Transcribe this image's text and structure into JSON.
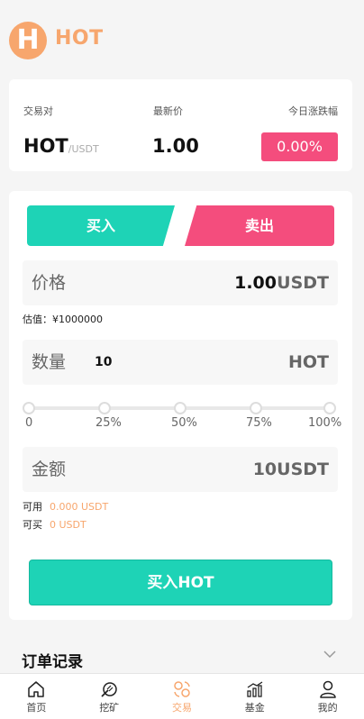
{
  "brand": {
    "logo_letter": "H",
    "name": "HOT"
  },
  "market": {
    "pair_label": "交易对",
    "latest_label": "最新价",
    "change_label": "今日涨跌幅",
    "pair_base": "HOT",
    "pair_quote": "/USDT",
    "price": "1.00",
    "change": "0.00%"
  },
  "trade": {
    "buy_tab": "买入",
    "sell_tab": "卖出",
    "price_label": "价格",
    "price_value": "1.00",
    "price_unit": "USDT",
    "estimate": "估值：¥1000000",
    "qty_label": "数量",
    "qty_value": "10",
    "qty_unit": "HOT",
    "slider_ticks": [
      "0",
      "25%",
      "50%",
      "75%",
      "100%"
    ],
    "amount_label": "金额",
    "amount_value": "10USDT",
    "available_label": "可用",
    "available_value": "0.000 USDT",
    "buyable_label": "可买",
    "buyable_value": "0 USDT",
    "submit": "买入HOT"
  },
  "orders": {
    "title": "订单记录"
  },
  "nav": {
    "items": [
      {
        "label": "首页",
        "icon": "home-icon"
      },
      {
        "label": "挖矿",
        "icon": "mining-icon"
      },
      {
        "label": "交易",
        "icon": "exchange-icon"
      },
      {
        "label": "基金",
        "icon": "fund-icon"
      },
      {
        "label": "我的",
        "icon": "user-icon"
      }
    ],
    "active": "交易"
  },
  "colors": {
    "accent": "#f7a66d",
    "buy": "#1ed3b6",
    "sell": "#f44d7d"
  }
}
